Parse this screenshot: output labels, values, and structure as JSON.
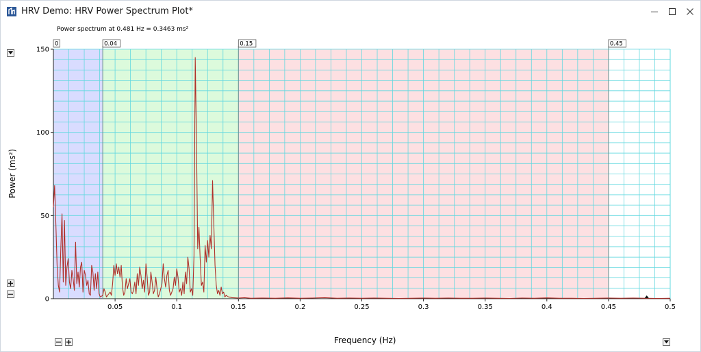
{
  "window": {
    "title": "HRV Demo: HRV Power Spectrum Plot*",
    "app_icon": "app-icon",
    "controls": [
      "minimize-icon",
      "maximize-icon",
      "close-icon"
    ]
  },
  "readout": "Power spectrum at 0.481 Hz = 0.3463 ms²",
  "controls": {
    "y_dropdown": "chevron-down-icon",
    "y_zoom_in": "plus-icon",
    "y_zoom_out": "minus-icon",
    "x_zoom_out": "minus-icon",
    "x_zoom_in": "plus-icon",
    "x_dropdown": "chevron-down-icon"
  },
  "colors": {
    "vlf_band": "#d9dcff",
    "lf_band": "#dcfadc",
    "hf_band": "#fde0e2",
    "upper_band": "#ffffff",
    "grid": "#62d8df",
    "curve": "#b0302a",
    "band_boundary": "#6f8f8f"
  },
  "chart_data": {
    "type": "line",
    "title": "",
    "xlabel": "Frequency (Hz)",
    "ylabel": "Power (ms²)",
    "xlim": [
      0,
      0.5
    ],
    "ylim": [
      0,
      150
    ],
    "x_ticks": [
      "0.05",
      "0.1",
      "0.15",
      "0.2",
      "0.25",
      "0.3",
      "0.35",
      "0.4",
      "0.45",
      "0.5"
    ],
    "y_ticks": [
      "0",
      "50",
      "100",
      "150"
    ],
    "grid": true,
    "bands": [
      {
        "label": "0",
        "from": 0,
        "to": 0.04
      },
      {
        "label": "0.04",
        "from": 0.04,
        "to": 0.15
      },
      {
        "label": "0.15",
        "from": 0.15,
        "to": 0.45
      },
      {
        "label": "0.45",
        "from": 0.45,
        "to": 0.5
      }
    ],
    "series": [
      {
        "points": [
          [
            0.0,
            55
          ],
          [
            0.001,
            68
          ],
          [
            0.002,
            45
          ],
          [
            0.003,
            20
          ],
          [
            0.004,
            8
          ],
          [
            0.005,
            4
          ],
          [
            0.006,
            30
          ],
          [
            0.007,
            51
          ],
          [
            0.008,
            10
          ],
          [
            0.009,
            47
          ],
          [
            0.01,
            8
          ],
          [
            0.011,
            19
          ],
          [
            0.012,
            24
          ],
          [
            0.013,
            10
          ],
          [
            0.014,
            6
          ],
          [
            0.015,
            17
          ],
          [
            0.016,
            12
          ],
          [
            0.017,
            5
          ],
          [
            0.018,
            34
          ],
          [
            0.019,
            9
          ],
          [
            0.02,
            16
          ],
          [
            0.021,
            7
          ],
          [
            0.022,
            19
          ],
          [
            0.023,
            22
          ],
          [
            0.024,
            4
          ],
          [
            0.025,
            17
          ],
          [
            0.026,
            14
          ],
          [
            0.027,
            8
          ],
          [
            0.028,
            11
          ],
          [
            0.029,
            3
          ],
          [
            0.03,
            2
          ],
          [
            0.031,
            20
          ],
          [
            0.032,
            16
          ],
          [
            0.033,
            5
          ],
          [
            0.034,
            15
          ],
          [
            0.035,
            6
          ],
          [
            0.036,
            16
          ],
          [
            0.037,
            3
          ],
          [
            0.038,
            1
          ],
          [
            0.04,
            2
          ],
          [
            0.041,
            6
          ],
          [
            0.042,
            4
          ],
          [
            0.043,
            1
          ],
          [
            0.044,
            2
          ],
          [
            0.046,
            4
          ],
          [
            0.047,
            2
          ],
          [
            0.048,
            9
          ],
          [
            0.049,
            20
          ],
          [
            0.05,
            14
          ],
          [
            0.051,
            21
          ],
          [
            0.052,
            15
          ],
          [
            0.053,
            19
          ],
          [
            0.054,
            13
          ],
          [
            0.055,
            20
          ],
          [
            0.056,
            7
          ],
          [
            0.057,
            2
          ],
          [
            0.058,
            4
          ],
          [
            0.059,
            12
          ],
          [
            0.06,
            6
          ],
          [
            0.062,
            12
          ],
          [
            0.063,
            4
          ],
          [
            0.064,
            3
          ],
          [
            0.065,
            5
          ],
          [
            0.066,
            10
          ],
          [
            0.067,
            3
          ],
          [
            0.068,
            15
          ],
          [
            0.069,
            8
          ],
          [
            0.07,
            19
          ],
          [
            0.071,
            14
          ],
          [
            0.072,
            6
          ],
          [
            0.073,
            11
          ],
          [
            0.074,
            4
          ],
          [
            0.075,
            21
          ],
          [
            0.076,
            13
          ],
          [
            0.077,
            2
          ],
          [
            0.078,
            4
          ],
          [
            0.079,
            16
          ],
          [
            0.08,
            10
          ],
          [
            0.081,
            3
          ],
          [
            0.082,
            5
          ],
          [
            0.083,
            13
          ],
          [
            0.084,
            6
          ],
          [
            0.085,
            1
          ],
          [
            0.086,
            3
          ],
          [
            0.088,
            9
          ],
          [
            0.089,
            21
          ],
          [
            0.09,
            12
          ],
          [
            0.091,
            7
          ],
          [
            0.092,
            14
          ],
          [
            0.093,
            17
          ],
          [
            0.094,
            5
          ],
          [
            0.095,
            2
          ],
          [
            0.096,
            4
          ],
          [
            0.097,
            6
          ],
          [
            0.098,
            13
          ],
          [
            0.099,
            8
          ],
          [
            0.1,
            18
          ],
          [
            0.101,
            13
          ],
          [
            0.102,
            4
          ],
          [
            0.103,
            6
          ],
          [
            0.104,
            2
          ],
          [
            0.105,
            10
          ],
          [
            0.106,
            3
          ],
          [
            0.107,
            16
          ],
          [
            0.108,
            9
          ],
          [
            0.109,
            25
          ],
          [
            0.11,
            18
          ],
          [
            0.111,
            4
          ],
          [
            0.112,
            6
          ],
          [
            0.113,
            2
          ],
          [
            0.114,
            26
          ],
          [
            0.115,
            145
          ],
          [
            0.116,
            95
          ],
          [
            0.117,
            30
          ],
          [
            0.118,
            43
          ],
          [
            0.119,
            24
          ],
          [
            0.12,
            8
          ],
          [
            0.121,
            10
          ],
          [
            0.122,
            4
          ],
          [
            0.123,
            32
          ],
          [
            0.124,
            22
          ],
          [
            0.125,
            35
          ],
          [
            0.126,
            25
          ],
          [
            0.127,
            38
          ],
          [
            0.128,
            30
          ],
          [
            0.129,
            71
          ],
          [
            0.13,
            45
          ],
          [
            0.131,
            20
          ],
          [
            0.132,
            8
          ],
          [
            0.133,
            3
          ],
          [
            0.134,
            5
          ],
          [
            0.135,
            2
          ],
          [
            0.136,
            7
          ],
          [
            0.137,
            3
          ],
          [
            0.138,
            4
          ],
          [
            0.139,
            1
          ],
          [
            0.14,
            2
          ],
          [
            0.142,
            1
          ],
          [
            0.145,
            0.6
          ],
          [
            0.15,
            0.4
          ],
          [
            0.155,
            0.6
          ],
          [
            0.16,
            0.3
          ],
          [
            0.17,
            0.4
          ],
          [
            0.18,
            0.3
          ],
          [
            0.19,
            0.5
          ],
          [
            0.2,
            0.3
          ],
          [
            0.21,
            0.4
          ],
          [
            0.22,
            0.6
          ],
          [
            0.23,
            0.3
          ],
          [
            0.24,
            0.4
          ],
          [
            0.25,
            0.3
          ],
          [
            0.26,
            0.4
          ],
          [
            0.27,
            0.3
          ],
          [
            0.28,
            0.2
          ],
          [
            0.29,
            0.3
          ],
          [
            0.3,
            0.4
          ],
          [
            0.31,
            0.3
          ],
          [
            0.32,
            0.4
          ],
          [
            0.33,
            0.3
          ],
          [
            0.34,
            0.3
          ],
          [
            0.35,
            0.4
          ],
          [
            0.36,
            0.3
          ],
          [
            0.37,
            0.2
          ],
          [
            0.38,
            0.4
          ],
          [
            0.39,
            0.3
          ],
          [
            0.4,
            0.5
          ],
          [
            0.41,
            0.3
          ],
          [
            0.42,
            0.3
          ],
          [
            0.43,
            0.2
          ],
          [
            0.44,
            0.3
          ],
          [
            0.45,
            0.4
          ],
          [
            0.46,
            0.3
          ],
          [
            0.47,
            0.4
          ],
          [
            0.48,
            0.3
          ],
          [
            0.49,
            0.2
          ],
          [
            0.5,
            0.3
          ]
        ]
      }
    ],
    "marker": {
      "x": 0.481,
      "y": 0.3463
    }
  }
}
